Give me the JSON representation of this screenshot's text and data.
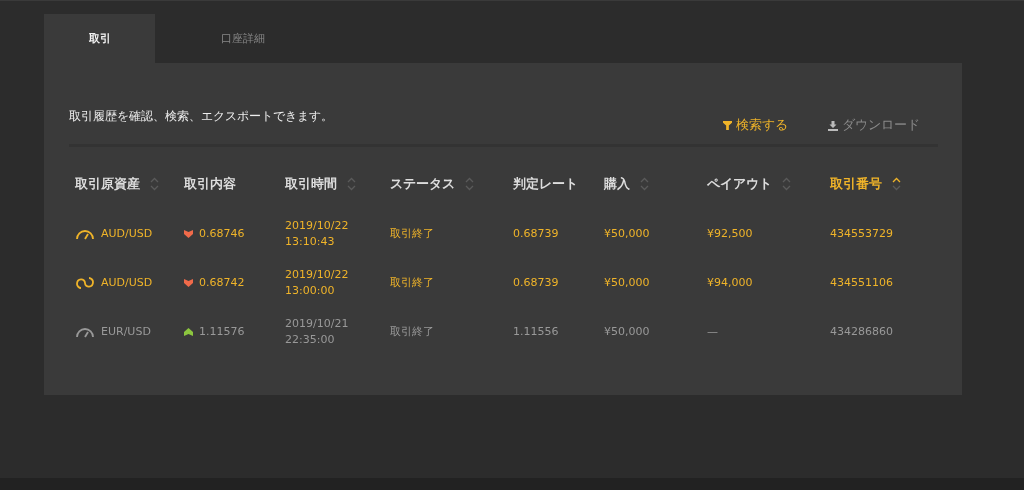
{
  "tabs": [
    {
      "label": "取引",
      "selected": true
    },
    {
      "label": "口座詳細",
      "selected": false
    }
  ],
  "description": "取引履歴を確認、検索、エクスポートできます。",
  "actions": [
    {
      "kind": "filter",
      "label": "検索する",
      "disabled": false
    },
    {
      "kind": "download",
      "label": "ダウンロード",
      "disabled": true
    }
  ],
  "table": {
    "columns": [
      {
        "label": "取引原資産",
        "sortable": true,
        "sorted": false
      },
      {
        "label": "取引内容",
        "sortable": false,
        "sorted": false
      },
      {
        "label": "取引時間",
        "sortable": true,
        "sorted": false
      },
      {
        "label": "ステータス",
        "sortable": true,
        "sorted": false
      },
      {
        "label": "判定レート",
        "sortable": false,
        "sorted": false
      },
      {
        "label": "購入",
        "sortable": true,
        "sorted": false
      },
      {
        "label": "ペイアウト",
        "sortable": true,
        "sorted": false
      },
      {
        "label": "取引番号",
        "sortable": true,
        "sorted": true
      }
    ],
    "rows": [
      {
        "won": true,
        "kind": "gauge",
        "asset": "AUD/USD",
        "rising": false,
        "rate": "0.68746",
        "date": "2019/10/22",
        "time": "13:10:43",
        "status": "取引終了",
        "judge_rate": "0.68739",
        "purchase": "¥50,000",
        "payout": "¥92,500",
        "number": "434553729"
      },
      {
        "won": true,
        "kind": "swap",
        "asset": "AUD/USD",
        "rising": false,
        "rate": "0.68742",
        "date": "2019/10/22",
        "time": "13:00:00",
        "status": "取引終了",
        "judge_rate": "0.68739",
        "purchase": "¥50,000",
        "payout": "¥94,000",
        "number": "434551106"
      },
      {
        "won": false,
        "kind": "gauge",
        "asset": "EUR/USD",
        "rising": true,
        "rate": "1.11576",
        "date": "2019/10/21",
        "time": "22:35:00",
        "status": "取引終了",
        "judge_rate": "1.11556",
        "purchase": "¥50,000",
        "payout": "—",
        "number": "434286860"
      }
    ]
  }
}
